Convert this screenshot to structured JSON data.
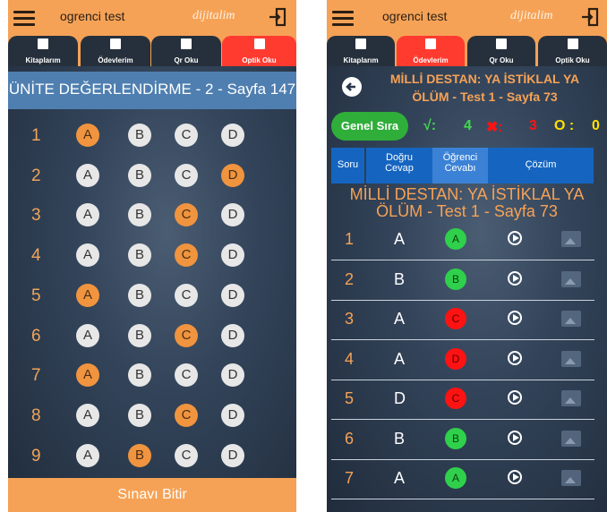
{
  "app_title": "ogrenci test",
  "brand": "dijitalim",
  "tabs": [
    {
      "label": "Kitaplarım",
      "icon": "book-icon"
    },
    {
      "label": "Ödevlerim",
      "icon": "homework-icon"
    },
    {
      "label": "Qr Oku",
      "icon": "qr-icon"
    },
    {
      "label": "Optik Oku",
      "icon": "optic-form-icon"
    }
  ],
  "colors": {
    "accent": "#f6a256",
    "active_tab": "#ff3b30",
    "correct": "#2fd04c",
    "wrong": "#ff1212",
    "header_blue": "#4f7fb0"
  },
  "left": {
    "active_tab": "Optik Oku",
    "exam_title": "ÜNİTE DEĞERLENDİRME - 2 - Sayfa 147",
    "options": [
      "A",
      "B",
      "C",
      "D"
    ],
    "questions": [
      {
        "num": "1",
        "selected": "A"
      },
      {
        "num": "2",
        "selected": "D"
      },
      {
        "num": "3",
        "selected": "C"
      },
      {
        "num": "4",
        "selected": "C"
      },
      {
        "num": "5",
        "selected": "A"
      },
      {
        "num": "6",
        "selected": "C"
      },
      {
        "num": "7",
        "selected": "A"
      },
      {
        "num": "8",
        "selected": "C"
      },
      {
        "num": "9",
        "selected": "B"
      }
    ],
    "finish_label": "Sınavı Bitir"
  },
  "right": {
    "active_tab": "Ödevlerim",
    "test_title_line1": "MİLLİ DESTAN: YA İSTİKLAL YA",
    "test_title_line2": "ÖLÜM - Test 1 - Sayfa 73",
    "rank_button": "Genel Sıra",
    "correct_symbol": "√:",
    "correct_count": "4",
    "wrong_symbol": "✖:",
    "wrong_count": "3",
    "empty_symbol": "O :",
    "empty_count": "0",
    "columns": {
      "question": "Soru",
      "correct_1": "Doğru",
      "correct_2": "Cevap",
      "student_1": "Öğrenci",
      "student_2": "Cevabı",
      "solution": "Çözüm"
    },
    "big_title_line1": "MİLLİ DESTAN: YA İSTİKLAL YA",
    "big_title_line2": "ÖLÜM - Test 1 - Sayfa 73",
    "answers": [
      {
        "num": "1",
        "correct": "A",
        "student": "A",
        "status": "ok"
      },
      {
        "num": "2",
        "correct": "B",
        "student": "B",
        "status": "ok"
      },
      {
        "num": "3",
        "correct": "A",
        "student": "C",
        "status": "bad"
      },
      {
        "num": "4",
        "correct": "A",
        "student": "D",
        "status": "bad"
      },
      {
        "num": "5",
        "correct": "D",
        "student": "C",
        "status": "bad"
      },
      {
        "num": "6",
        "correct": "B",
        "student": "B",
        "status": "ok"
      },
      {
        "num": "7",
        "correct": "A",
        "student": "A",
        "status": "ok"
      }
    ]
  }
}
